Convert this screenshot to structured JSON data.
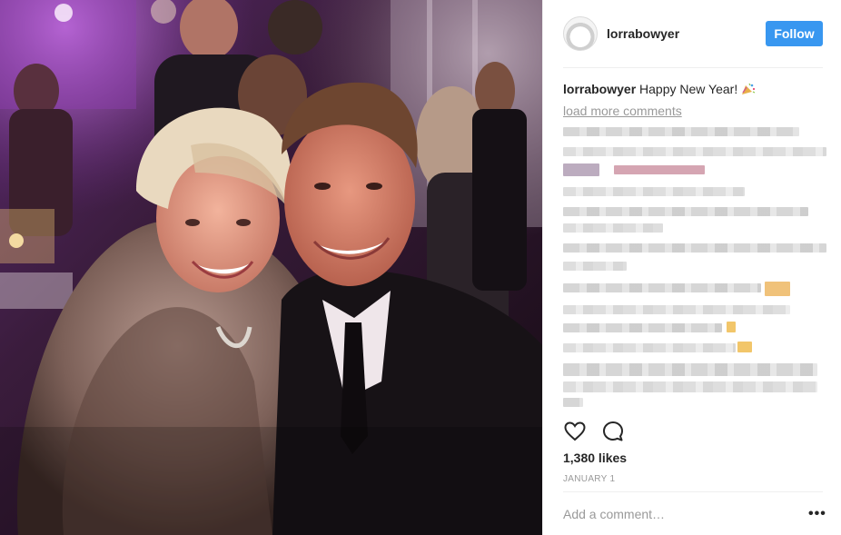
{
  "post": {
    "photo_alt": "Photo by lorrabowyer",
    "username": "lorrabowyer",
    "follow_label": "Follow",
    "caption": {
      "user": "lorrabowyer",
      "text": "Happy New Year!"
    },
    "load_more_label": "load more comments",
    "likes_label": "1,380 likes",
    "date_label": "JANUARY 1",
    "comment_placeholder": "Add a comment…",
    "more_options_label": "•••"
  },
  "colors": {
    "follow_button": "#3897f0",
    "muted_text": "#999999",
    "primary_text": "#262626",
    "divider": "#efefef"
  },
  "icons": {
    "like": "heart-outline-icon",
    "comment": "speech-bubble-icon",
    "caption_emoji": "party-popper-icon"
  }
}
